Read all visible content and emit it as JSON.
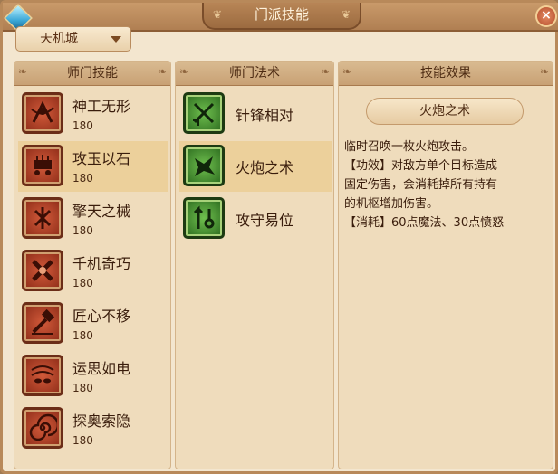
{
  "window": {
    "title": "门派技能",
    "close_glyph": "×"
  },
  "school_select": {
    "value": "天机城"
  },
  "skills_panel": {
    "header": "师门技能",
    "items": [
      {
        "name": "神工无形",
        "level": "180",
        "icon": "divine-craft-icon"
      },
      {
        "name": "攻玉以石",
        "level": "180",
        "icon": "jade-stone-icon",
        "selected": true
      },
      {
        "name": "擎天之械",
        "level": "180",
        "icon": "sky-machine-icon"
      },
      {
        "name": "千机奇巧",
        "level": "180",
        "icon": "thousand-machine-icon"
      },
      {
        "name": "匠心不移",
        "level": "180",
        "icon": "craftsman-heart-icon"
      },
      {
        "name": "运思如电",
        "level": "180",
        "icon": "lightning-thought-icon"
      },
      {
        "name": "探奥索隐",
        "level": "180",
        "icon": "explore-secret-icon"
      }
    ]
  },
  "spells_panel": {
    "header": "师门法术",
    "items": [
      {
        "name": "针锋相对",
        "icon": "crossed-needles-icon"
      },
      {
        "name": "火炮之术",
        "icon": "cannon-icon",
        "selected": true
      },
      {
        "name": "攻守易位",
        "icon": "switch-position-icon"
      }
    ]
  },
  "effect_panel": {
    "header": "技能效果",
    "skill_title": "火炮之术",
    "lines": [
      "临时召唤一枚火炮攻击。",
      "【功效】对敌方单个目标造成",
      "固定伤害，会消耗掉所有持有",
      "的机枢增加伤害。",
      "【消耗】60点魔法、30点愤怒"
    ]
  },
  "colors": {
    "window_bg": "#f3e6cf",
    "panel_bg": "#efdcbc",
    "selected_row": "#ecd09b",
    "skill_icon_red": "#b2412a",
    "spell_icon_green": "#4a9a35",
    "text_dark": "#3a1d0c"
  }
}
